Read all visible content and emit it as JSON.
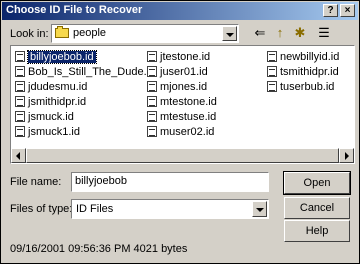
{
  "window": {
    "title": "Choose ID File to Recover",
    "help_btn": "?",
    "close_btn": "×"
  },
  "lookin": {
    "label": "Look in:",
    "value": "people"
  },
  "toolbar": {
    "back_icon": "⇐",
    "up_icon": "↑",
    "newfolder_icon": "✱",
    "view_icon": "☰"
  },
  "files": [
    [
      "billyjoebob.id",
      "Bob_Is_Still_The_Dude.id",
      "jdudesmu.id",
      "jsmithidpr.id",
      "jsmuck.id",
      "jsmuck1.id"
    ],
    [
      "jtestone.id",
      "juser01.id",
      "mjones.id",
      "mtestone.id",
      "mtestuse.id",
      "muser02.id"
    ],
    [
      "newbillyid.id",
      "tsmithidpr.id",
      "tuserbub.id"
    ]
  ],
  "selected_file": "billyjoebob.id",
  "filename": {
    "label": "File name:",
    "value": "billyjoebob"
  },
  "filetype": {
    "label": "Files of type:",
    "value": "ID Files"
  },
  "buttons": {
    "open": "Open",
    "cancel": "Cancel",
    "help": "Help"
  },
  "status": "09/16/2001 09:56:36 PM 4021 bytes"
}
